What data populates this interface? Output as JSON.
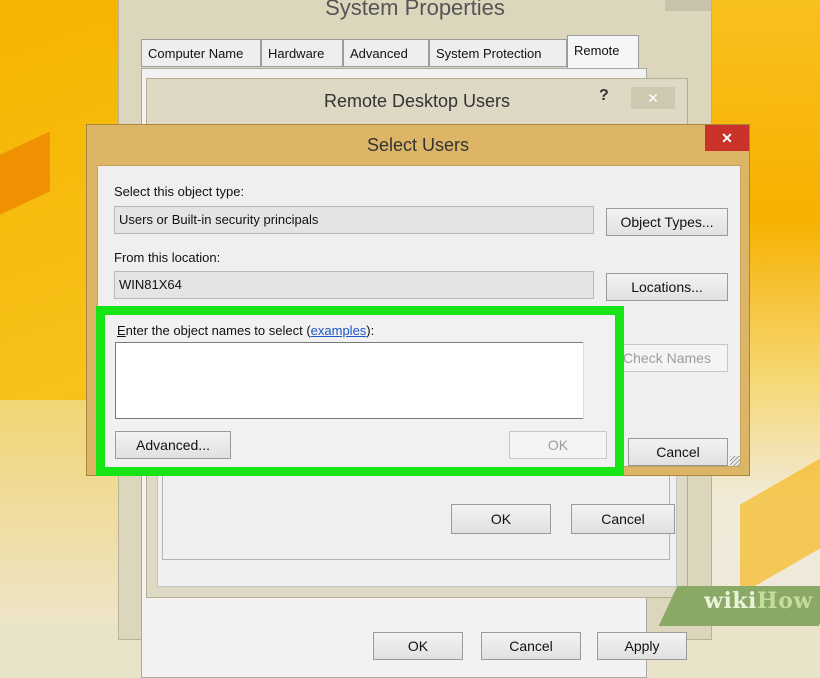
{
  "system_properties": {
    "title": "System Properties",
    "tabs": [
      {
        "label": "Computer Name"
      },
      {
        "label": "Hardware"
      },
      {
        "label": "Advanced"
      },
      {
        "label": "System Protection"
      },
      {
        "label": "Remote",
        "active": true
      }
    ],
    "buttons": {
      "ok": "OK",
      "cancel": "Cancel",
      "apply": "Apply"
    }
  },
  "remote_desktop_users": {
    "title": "Remote Desktop Users",
    "help": "?",
    "close": "✕",
    "buttons": {
      "ok": "OK",
      "cancel": "Cancel"
    }
  },
  "select_users": {
    "title": "Select Users",
    "close": "✕",
    "object_type_label": "Select this object type:",
    "object_type_value": "Users or Built-in security principals",
    "object_types_button": "Object Types...",
    "location_label": "From this location:",
    "location_value": "WIN81X64",
    "locations_button": "Locations...",
    "enter_names_label_accel": "E",
    "enter_names_label_rest": "nter the object names to select (",
    "examples_link": "examples",
    "enter_names_label_end": "):",
    "names_value": "",
    "check_names_button": "Check Names",
    "advanced_button": "Advanced...",
    "ok_button": "OK",
    "cancel_button": "Cancel"
  },
  "watermark": {
    "part1": "wiki",
    "part2": "How"
  },
  "colors": {
    "highlight": "#16e416",
    "select_users_frame": "#dcb567",
    "close_button": "#c9312a",
    "link": "#1d56c6"
  }
}
